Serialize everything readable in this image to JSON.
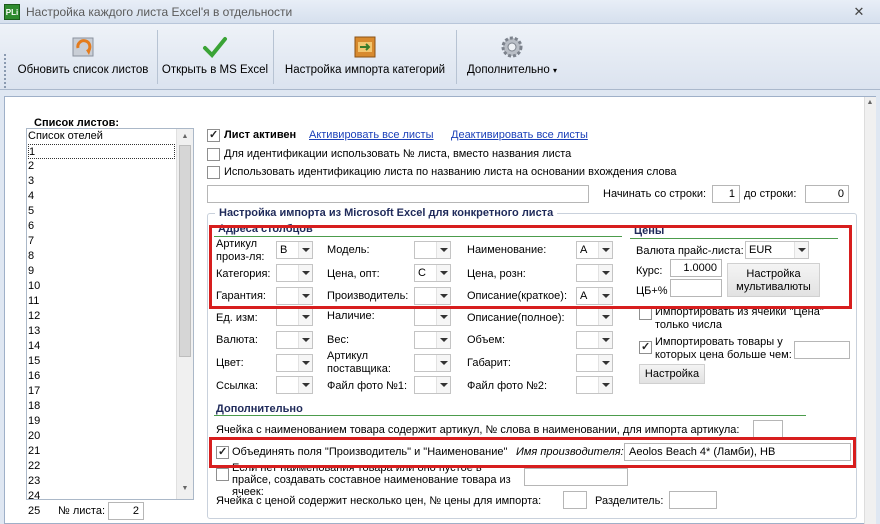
{
  "window": {
    "title": "Настройка каждого листа Excel'я в отдельности",
    "app_icon_text": "PLi",
    "close": "✕"
  },
  "toolbar": {
    "refresh": "Обновить список листов",
    "open_excel": "Открыть в MS Excel",
    "import_settings": "Настройка импорта категорий",
    "more": "Дополнительно"
  },
  "sheets": {
    "header": "Список листов:",
    "items": [
      "Список отелей",
      "1",
      "2",
      "3",
      "4",
      "5",
      "6",
      "7",
      "8",
      "9",
      "10",
      "11",
      "12",
      "13",
      "14",
      "15",
      "16",
      "17",
      "18",
      "19",
      "20",
      "21",
      "22",
      "23",
      "24",
      "25"
    ],
    "selected_index": 1,
    "num_label": "№ листа:",
    "num_value": "2"
  },
  "top": {
    "sheet_active": "Лист активен",
    "activate_all": "Активировать все листы",
    "deactivate_all": "Деактивировать все листы",
    "use_number": "Для идентификации использовать № листа, вместо названия листа",
    "use_name_part": "Использовать идентификацию листа по названию листа на основании вхождения слова",
    "start_row_label": "Начинать со строки:",
    "start_row": "1",
    "to_row_label": "до строки:",
    "to_row": "0"
  },
  "import": {
    "title": "Настройка импорта из Microsoft Excel для конкретного листа",
    "addr_title": "Адреса столбцов",
    "prices_title": "Цены",
    "fields": {
      "article": "Артикул произ-ля:",
      "article_v": "B",
      "model": "Модель:",
      "model_v": "",
      "name": "Наименование:",
      "name_v": "A",
      "category": "Категория:",
      "category_v": "",
      "price_opt": "Цена, опт:",
      "price_opt_v": "C",
      "price_retail": "Цена, розн:",
      "price_retail_v": "",
      "warranty": "Гарантия:",
      "warranty_v": "",
      "manufacturer": "Производитель:",
      "manufacturer_v": "",
      "desc_short": "Описание(краткое):",
      "desc_short_v": "A",
      "unit": "Ед. изм:",
      "availability": "Наличие:",
      "desc_full": "Описание(полное):",
      "currency": "Валюта:",
      "weight": "Вес:",
      "volume": "Объем:",
      "color": "Цвет:",
      "supplier_article": "Артикул поставщика:",
      "dimensions": "Габарит:",
      "link": "Ссылка:",
      "photo1": "Файл фото №1:",
      "photo2": "Файл фото №2:"
    },
    "price": {
      "currency_label": "Валюта прайс-листа:",
      "currency_value": "EUR",
      "rate_label": "Курс:",
      "rate_value": "1.0000",
      "cb_label": "ЦБ+%",
      "cb_value": "",
      "multi_btn": "Настройка мультивалюты",
      "import_from_cell": "Импортировать из ячейки \"Цена\" только числа",
      "import_greater": "Импортировать товары у которых цена больше чем:",
      "settings_btn": "Настройка"
    },
    "extra": {
      "title": "Дополнительно",
      "name_contains_article": "Ячейка с наименованием товара содержит артикул, № слова в наименовании, для импорта артикула:",
      "merge_fields": "Объединять поля \"Производитель\" и \"Наименование\"",
      "manufacturer_name_label": "Имя производителя:",
      "manufacturer_name_value": "Aeolos Beach 4* (Ламби), HB",
      "empty_name": "Если нет наименования товара или оно пустое в прайсе, создавать составное наименование товара из ячеек:",
      "multi_price": "Ячейка с ценой содержит несколько цен, № цены для импорта:",
      "separator": "Разделитель:"
    }
  },
  "colors": {
    "highlight": "#d71e1e",
    "group_line": "#4c9c4c",
    "link": "#1a3fb8"
  }
}
